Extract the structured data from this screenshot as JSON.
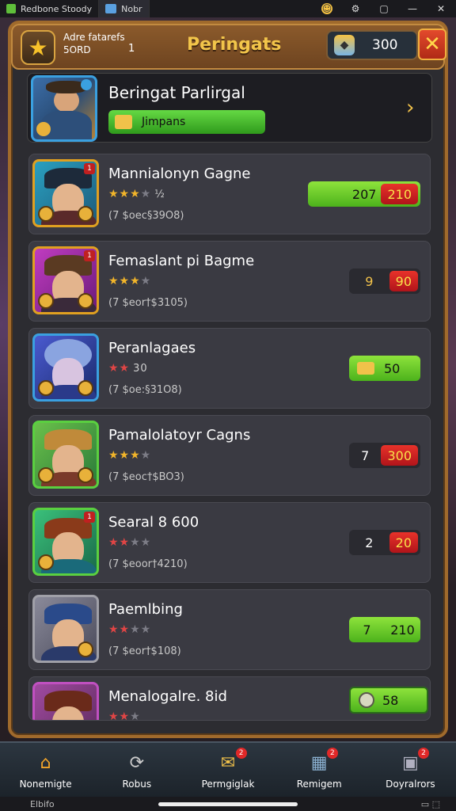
{
  "system_bar": {
    "tab1": "Redbone Stoody",
    "tab2": "Nobr"
  },
  "header": {
    "sub_line1": "Adre fatarefs",
    "sub_line2": "5ORD",
    "mid_icon_text": "1",
    "title": "Peringats",
    "coins": "300"
  },
  "featured": {
    "title": "Beringat Parlirgal",
    "button_label": "Jimpans"
  },
  "rows": [
    {
      "title": "Mannialonyn Gagne",
      "stars": [
        "on",
        "on",
        "on"
      ],
      "stars_extra": "½",
      "sub": "(7 $oec§39O8)",
      "pill_left": "207",
      "pill_right": "210",
      "pill_style": "green"
    },
    {
      "title": "Femaslant pi Bagme",
      "stars": [
        "on",
        "on",
        "on",
        "off"
      ],
      "stars_extra": "",
      "sub": "(7 $eor†$3105)",
      "pill_left": "9",
      "pill_right": "90",
      "pill_style": "dark"
    },
    {
      "title": "Peranlagaes",
      "stars": [
        "red",
        "red"
      ],
      "stars_extra": "30",
      "sub": "(7 $oe:§31O8)",
      "pill_left": "",
      "pill_right": "50",
      "pill_style": "green-icon"
    },
    {
      "title": "Pamalolatoyr Cagns",
      "stars": [
        "on",
        "on",
        "on",
        "off"
      ],
      "stars_extra": "",
      "sub": "(7 $eoc†$BO3)",
      "pill_left": "7",
      "pill_right": "300",
      "pill_style": "dark"
    },
    {
      "title": "Searal 8 600",
      "stars": [
        "red",
        "red",
        "off",
        "off"
      ],
      "stars_extra": "",
      "sub": "(7 $eoor†4210)",
      "pill_left": "2",
      "pill_right": "20",
      "pill_style": "dark"
    },
    {
      "title": "Paemlbing",
      "stars": [
        "red",
        "red",
        "off",
        "off"
      ],
      "stars_extra": "",
      "sub": "(7 $eor†$108)",
      "pill_left": "7",
      "pill_right": "210",
      "pill_style": "green-plain"
    },
    {
      "title": "Menalogalre. 8id",
      "stars": [
        "red",
        "red",
        "off"
      ],
      "stars_extra": "",
      "sub": "",
      "pill_left": "",
      "pill_right": "58",
      "pill_style": "green-coin"
    }
  ],
  "nav": [
    {
      "label": "Nonemigte",
      "icon": "home-icon",
      "badge": ""
    },
    {
      "label": "Robus",
      "icon": "refresh-icon",
      "badge": ""
    },
    {
      "label": "Permgiglak",
      "icon": "ticket-icon",
      "badge": "2"
    },
    {
      "label": "Remigem",
      "icon": "map-icon",
      "badge": "2"
    },
    {
      "label": "Doyralrors",
      "icon": "chest-icon",
      "badge": "2"
    }
  ],
  "home_bar": {
    "left_text": "Elbifo"
  },
  "colors": {
    "accent": "#f2c54a",
    "frame": "#a06a2c",
    "green": "#4cb21c",
    "red": "#b0141a"
  }
}
